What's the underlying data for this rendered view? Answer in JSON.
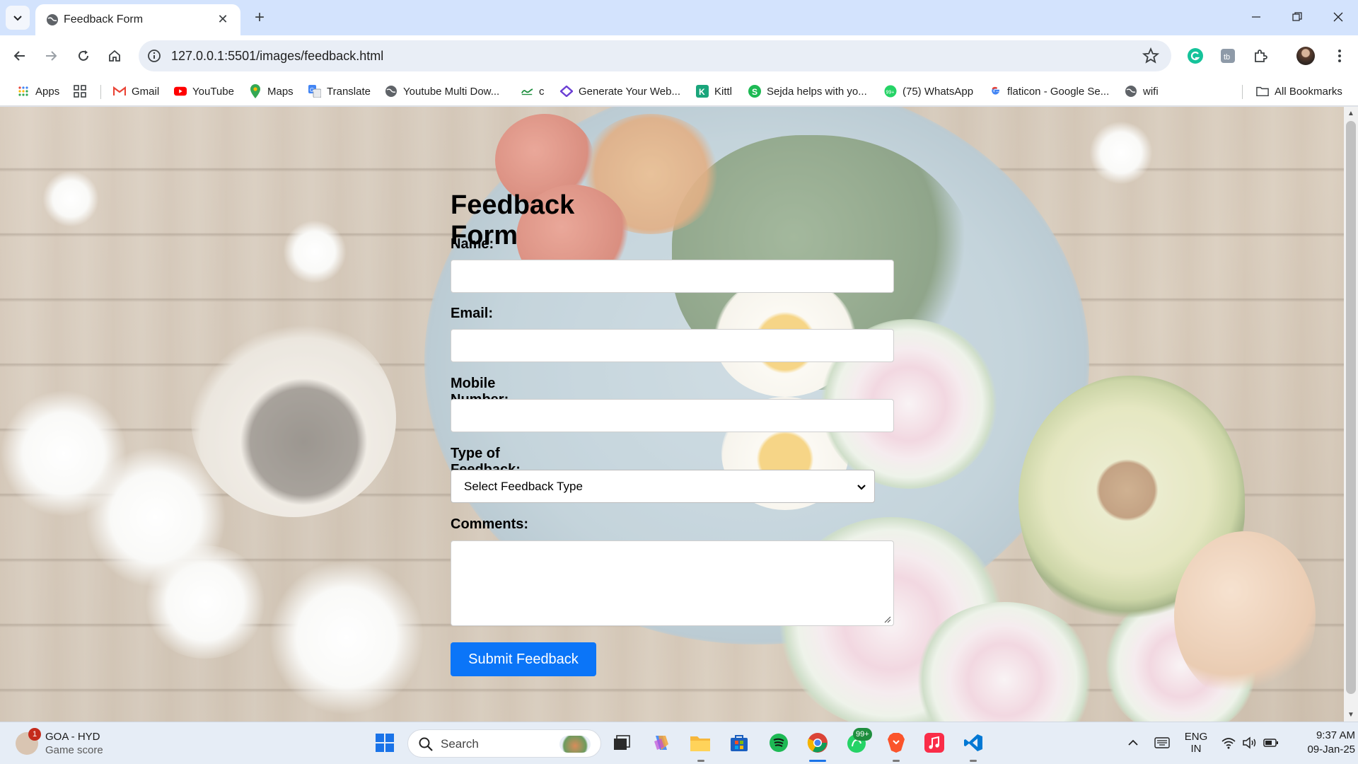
{
  "browser": {
    "tab_title": "Feedback Form",
    "url": "127.0.0.1:5501/images/feedback.html"
  },
  "bookmarks": {
    "apps": "Apps",
    "gmail": "Gmail",
    "youtube": "YouTube",
    "maps": "Maps",
    "translate": "Translate",
    "youtube_multi": "Youtube Multi Dow...",
    "c": "c",
    "generate": "Generate Your Web...",
    "kittl": "Kittl",
    "sejda": "Sejda helps with yo...",
    "whatsapp": "(75) WhatsApp",
    "flaticon": "flaticon - Google Se...",
    "wifi": "wifi",
    "all_bookmarks": "All Bookmarks"
  },
  "form": {
    "title": "Feedback Form",
    "name_label": "Name:",
    "email_label": "Email:",
    "mobile_label": "Mobile Number:",
    "type_label": "Type of Feedback:",
    "type_selected": "Select Feedback Type",
    "comments_label": "Comments:",
    "submit_label": "Submit Feedback"
  },
  "taskbar": {
    "weather_badge": "1",
    "weather_title": "GOA - HYD",
    "weather_sub": "Game score",
    "search_placeholder": "Search",
    "whatsapp_badge": "99+",
    "lang_top": "ENG",
    "lang_bottom": "IN",
    "time": "9:37 AM",
    "date": "09-Jan-25"
  },
  "colors": {
    "submit_button": "#0b75f8",
    "tab_strip": "#d3e3fd"
  }
}
